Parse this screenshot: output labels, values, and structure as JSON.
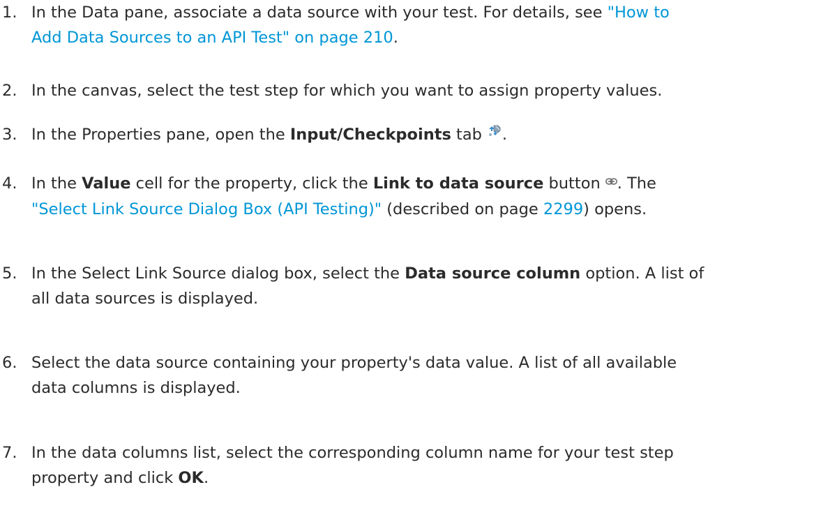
{
  "steps": [
    {
      "number": "1.",
      "lines": [
        {
          "pre": "In the Data pane, associate a data source with your test. For details, see ",
          "link": "\"How to"
        },
        {
          "link": "Add Data Sources to an API Test\" on page 210",
          "post": "."
        }
      ]
    },
    {
      "number": "2.",
      "text": "In the canvas, select the test step for which you want to assign property values."
    },
    {
      "number": "3.",
      "pre": "In the Properties pane, open the ",
      "bold": "Input/Checkpoints",
      "post": " tab",
      "end": ".",
      "icon": "input-checkpoints-tab-icon"
    },
    {
      "number": "4.",
      "line1": {
        "pre": "In the ",
        "bold1": "Value",
        "mid": " cell for the property, click the ",
        "bold2": "Link to data source",
        "post": " button",
        "icon": "link-to-data-source-icon",
        "end": ". The"
      },
      "line2": {
        "link": "\"Select Link Source Dialog Box (API Testing)\"",
        "mid": " (described on page ",
        "page": "2299",
        "post": ") opens."
      }
    },
    {
      "number": "5.",
      "line1": {
        "pre": "In the Select Link Source dialog box, select the ",
        "bold": "Data source column",
        "post": " option. A list of"
      },
      "line2": "all data sources is displayed."
    },
    {
      "number": "6.",
      "line1": "Select the data source containing your property's data value. A list of all available",
      "line2": "data columns is displayed."
    },
    {
      "number": "7.",
      "line1": "In the data columns list, select the corresponding column name for your test step",
      "line2": {
        "pre": "property and click ",
        "bold": "OK",
        "post": "."
      }
    }
  ],
  "colors": {
    "text": "#2b2b2b",
    "link": "#0096d6"
  }
}
